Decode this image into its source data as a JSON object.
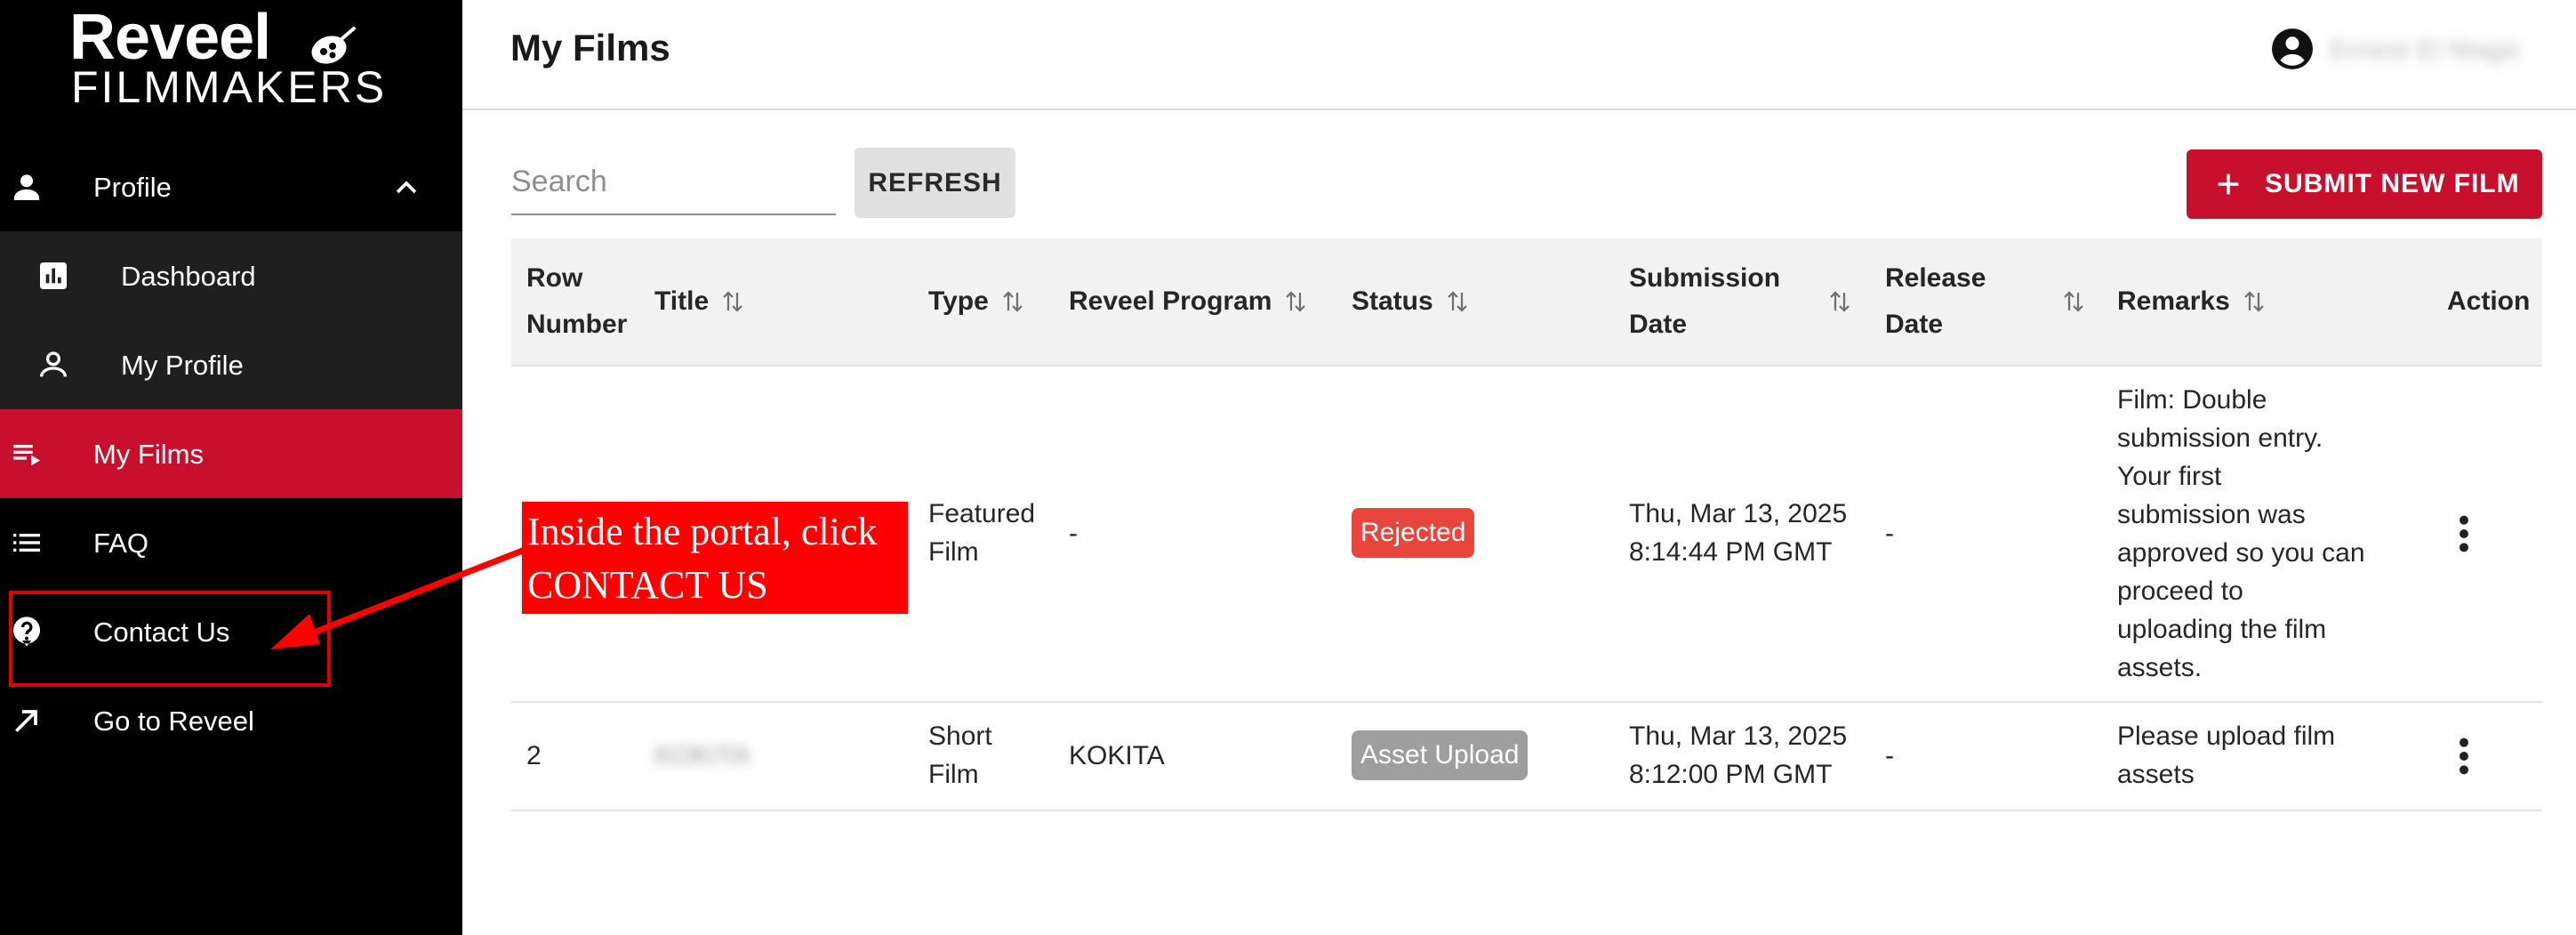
{
  "brand": {
    "line1": "Reveel",
    "line2": "FILMMAKERS"
  },
  "sidebar": {
    "items": [
      {
        "label": "Profile",
        "icon": "person-icon"
      },
      {
        "label": "Dashboard",
        "icon": "bar-chart-icon"
      },
      {
        "label": "My Profile",
        "icon": "person-outline-icon"
      },
      {
        "label": "My Films",
        "icon": "playlist-play-icon"
      },
      {
        "label": "FAQ",
        "icon": "list-icon"
      },
      {
        "label": "Contact Us",
        "icon": "help-circle-icon"
      },
      {
        "label": "Go to Reveel",
        "icon": "arrow-up-right-icon"
      }
    ]
  },
  "header": {
    "title": "My Films",
    "user_name": "Ernest El Magic"
  },
  "toolbar": {
    "search_placeholder": "Search",
    "refresh_label": "REFRESH",
    "submit_label": "SUBMIT NEW FILM"
  },
  "table": {
    "columns": {
      "row_number_1": "Row",
      "row_number_2": "Number",
      "title": "Title",
      "type": "Type",
      "program": "Reveel Program",
      "status": "Status",
      "submission_1": "Submission",
      "submission_2": "Date",
      "release_1": "Release",
      "release_2": "Date",
      "remarks": "Remarks",
      "action": "Action"
    },
    "rows": [
      {
        "row_number": "",
        "title": "",
        "type_1": "Featured",
        "type_2": "Film",
        "program": "-",
        "status": "Rejected",
        "status_color": "#e8453c",
        "submission_1": "Thu, Mar 13, 2025",
        "submission_2": "8:14:44 PM GMT",
        "release": "-",
        "remarks": [
          "Film: Double",
          "submission entry.",
          "Your first",
          "submission was",
          "approved so you can",
          "proceed to",
          "uploading the film",
          "assets."
        ]
      },
      {
        "row_number": "2",
        "title": "KOKITA",
        "type_1": "Short",
        "type_2": "Film",
        "program": "KOKITA",
        "status": "Asset Upload",
        "status_color": "#9e9e9e",
        "submission_1": "Thu, Mar 13, 2025",
        "submission_2": "8:12:00 PM GMT",
        "release": "-",
        "remarks": [
          "Please upload film",
          "assets"
        ]
      }
    ]
  },
  "annotation": {
    "line1": "Inside the portal, click",
    "line2": "CONTACT US"
  },
  "colors": {
    "accent": "#c8102e",
    "sidebar_bg": "#000000",
    "sub_bg": "#1f1f1f",
    "annotation": "#ff0000"
  }
}
